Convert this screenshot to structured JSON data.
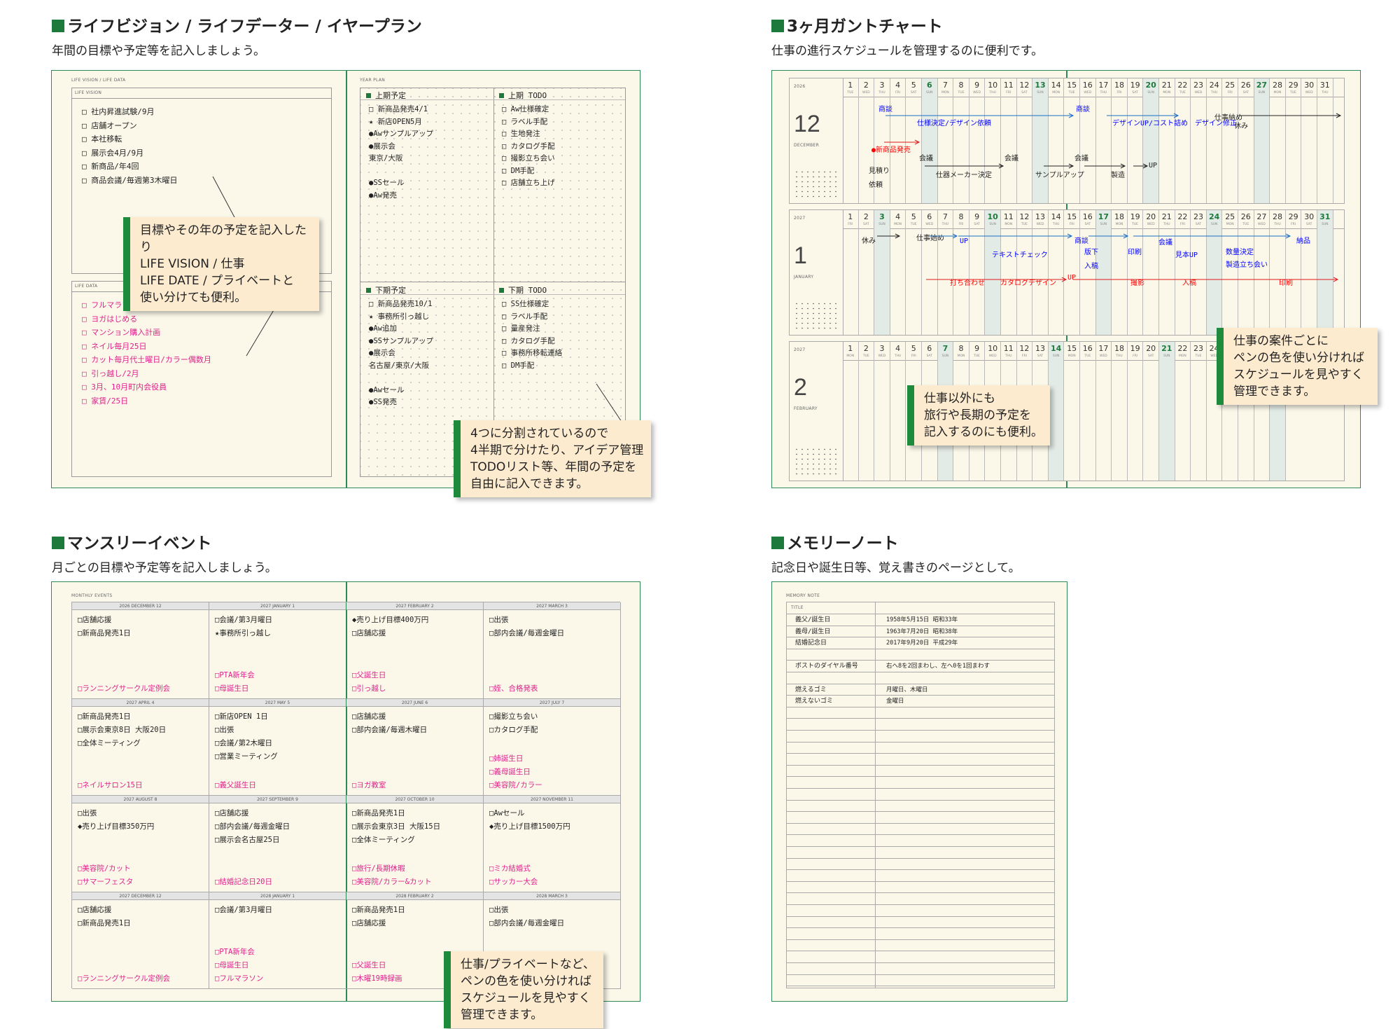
{
  "sections": {
    "life": {
      "title": "ライフビジョン / ライフデーター / イヤープラン",
      "sub": "年間の目標や予定等を記入しましょう。"
    },
    "gantt": {
      "title": "3ヶ月ガントチャート",
      "sub": "仕事の進行スケジュールを管理するのに便利です。"
    },
    "monthly": {
      "title": "マンスリーイベント",
      "sub": "月ごとの目標や予定等を記入しましょう。"
    },
    "memory": {
      "title": "メモリーノート",
      "sub": "記念日や誕生日等、覚え書きのページとして。"
    }
  },
  "life_page": {
    "header_left": "LIFE VISION / LIFE DATA",
    "vision_label": "LIFE VISION",
    "vision_items": [
      "□ 社内昇進試験/9月",
      "□ 店舗オープン",
      "□ 本社移転",
      "□ 展示会4月/9月",
      "□ 新商品/年4回",
      "□ 商品会議/毎週第3木曜日"
    ],
    "data_label": "LIFE DATA",
    "data_items": [
      "□ フルマラソン完走!",
      "□ ヨガはじめる",
      "□ マンション購入計画",
      "□ ネイル毎月25日",
      "□ カット毎月代土曜日/カラー偶数月",
      "□ 引っ越し/2月",
      "□ 3月、10月町内会役員",
      "□ 家賃/25日"
    ],
    "header_right": "YEAR PLAN",
    "q1_head": "上期予定",
    "q1_items": [
      "□ 新商品発売4/1",
      "★ 新店OPEN5月",
      "●Awサンプルアップ",
      "●展示会",
      "  東京/大阪",
      "",
      "●SSセール",
      "●Aw発売"
    ],
    "q2_head": "上期 TODO",
    "q2_items": [
      "□ Aw仕様確定",
      "□ ラベル手配",
      "□ 生地発注",
      "□ カタログ手配",
      "□ 撮影立ち会い",
      "□ DM手配",
      "□ 店舗立ち上げ"
    ],
    "q3_head": "下期予定",
    "q3_items": [
      "□ 新商品発売10/1",
      "★ 事務所引っ越し",
      "●Aw追加",
      "●SSサンプルアップ",
      "●展示会",
      "  名古屋/東京/大阪",
      "",
      "●Awセール",
      "●SS発売"
    ],
    "q4_head": "下期 TODO",
    "q4_items": [
      "□ SS仕様確定",
      "□ ラベル手配",
      "□ 量産発注",
      "□ カタログ手配",
      "□ 事務所移転連絡",
      "□ DM手配"
    ],
    "callout1": [
      "目標やその年の予定を記入したり",
      "LIFE VISION / 仕事",
      "LIFE DATE / プライベートと",
      "使い分けても便利。"
    ],
    "callout2": [
      "4つに分割されているので",
      "4半期で分けたり、アイデア管理",
      "TODOリスト等、年間の予定を",
      "自由に記入できます。"
    ]
  },
  "gantt_page": {
    "months": [
      {
        "year": "2026",
        "num": "12",
        "name": "DECEMBER"
      },
      {
        "year": "2027",
        "num": "1",
        "name": "JANUARY"
      },
      {
        "year": "2027",
        "num": "2",
        "name": "FEBRUARY"
      }
    ],
    "dec_texts": [
      "商談",
      "仕様決定/デザイン依頼",
      "商談",
      "デザインUP/コスト詰め",
      "デザイン修正",
      "仕事納め",
      "休み",
      "●新商品発売",
      "見積り",
      "依頼",
      "会議",
      "仕器メーカー決定",
      "会議",
      "サンプルアップ",
      "会議",
      "製造",
      "UP"
    ],
    "jan_texts": [
      "休み",
      "仕事始め",
      "UP",
      "テキストチェック",
      "商談",
      "版下",
      "入稿",
      "印刷",
      "会議",
      "見本UP",
      "数量決定",
      "製造立ち会い",
      "納品",
      "打ち合わせ",
      "カタログデザイン",
      "UP",
      "撮影",
      "入稿",
      "印刷"
    ],
    "callout1": [
      "仕事以外にも",
      "旅行や長期の予定を",
      "記入するのにも便利。"
    ],
    "callout2": [
      "仕事の案件ごとに",
      "ペンの色を使い分ければ",
      "スケジュールを見やすく",
      "管理できます。"
    ]
  },
  "monthly_page": {
    "header": "MONTHLY EVENTS",
    "cells": [
      {
        "head": "2026 DECEMBER 12",
        "top": [
          "□店舗応援",
          "□新商品発売1日"
        ],
        "bot": [
          "□ランニングサークル定例会"
        ]
      },
      {
        "head": "2027 JANUARY 1",
        "top": [
          "□会議/第3月曜日",
          "★事務所引っ越し"
        ],
        "bot": [
          "□PTA新年会",
          "□母誕生日"
        ]
      },
      {
        "head": "2027 FEBRUARY 2",
        "top": [
          "◆売り上げ目標400万円",
          "□店舗応援"
        ],
        "bot": [
          "□父誕生日",
          "□引っ越し"
        ]
      },
      {
        "head": "2027 MARCH 3",
        "top": [
          "□出張",
          "□部内会議/毎週金曜日"
        ],
        "bot": [
          "□姪、合格発表"
        ]
      },
      {
        "head": "2027 APRIL 4",
        "top": [
          "□新商品発売1日",
          "□展示会東京8日 大阪20日",
          "□全体ミーティング"
        ],
        "bot": [
          "□ネイルサロン15日"
        ]
      },
      {
        "head": "2027 MAY 5",
        "top": [
          "□新店OPEN 1日",
          "□出張",
          "□会議/第2木曜日",
          "□営業ミーティング"
        ],
        "bot": [
          "□義父誕生日"
        ]
      },
      {
        "head": "2027 JUNE 6",
        "top": [
          "□店舗応援",
          "□部内会議/毎週木曜日"
        ],
        "bot": [
          "□ヨガ教室"
        ]
      },
      {
        "head": "2027 JULY 7",
        "top": [
          "□撮影立ち会い",
          "□カタログ手配"
        ],
        "bot": [
          "□姉誕生日",
          "□義母誕生日",
          "□美容院/カラー"
        ]
      },
      {
        "head": "2027 AUGUST 8",
        "top": [
          "□出張",
          "◆売り上げ目標350万円"
        ],
        "bot": [
          "□美容院/カット",
          "□サマーフェスタ"
        ]
      },
      {
        "head": "2027 SEPTEMBER 9",
        "top": [
          "□店舗応援",
          "□部内会議/毎週金曜日",
          "□展示会名古屋25日"
        ],
        "bot": [
          "□結婚記念日20日"
        ]
      },
      {
        "head": "2027 OCTOBER 10",
        "top": [
          "□新商品発売1日",
          "□展示会東京3日 大阪15日",
          "□全体ミーティング"
        ],
        "bot": [
          "□旅行/長期休暇",
          "□美容院/カラー&カット"
        ]
      },
      {
        "head": "2027 NOVEMBER 11",
        "top": [
          "□Awセール",
          "◆売り上げ目標1500万円"
        ],
        "bot": [
          "□ミカ結婚式",
          "□サッカー大会"
        ]
      },
      {
        "head": "2027 DECEMBER 12",
        "top": [
          "□店舗応援",
          "□新商品発売1日"
        ],
        "bot": [
          "□ランニングサークル定例会"
        ]
      },
      {
        "head": "2028 JANUARY 1",
        "top": [
          "□会議/第3月曜日"
        ],
        "bot": [
          "□PTA新年会",
          "□母誕生日",
          "□フルマラソン"
        ]
      },
      {
        "head": "2028 FEBRUARY 2",
        "top": [
          "□新商品発売1日",
          "□店舗応援"
        ],
        "bot": [
          "□父誕生日",
          "□木曜19時録画"
        ]
      },
      {
        "head": "2028 MARCH 3",
        "top": [
          "□出張",
          "□部内会議/毎週金曜日"
        ],
        "bot": []
      }
    ],
    "callout": [
      "仕事/プライベートなど、",
      "ペンの色を使い分ければ",
      "スケジュールを見やすく",
      "管理できます。"
    ]
  },
  "memory_page": {
    "header": "MEMORY NOTE",
    "col_title": "TITLE",
    "rows": [
      {
        "k": "義父/誕生日",
        "v": "1958年5月15日  昭和33年"
      },
      {
        "k": "義母/誕生日",
        "v": "1963年7月20日  昭和38年"
      },
      {
        "k": "結婚記念日",
        "v": "2017年9月20日  平成29年"
      },
      {
        "k": "",
        "v": ""
      },
      {
        "k": "ポストのダイヤル番号",
        "v": "右へ8を2回まわし、左へ0を1回まわす"
      },
      {
        "k": "",
        "v": ""
      },
      {
        "k": "燃えるゴミ",
        "v": "月曜日、木曜日"
      },
      {
        "k": "燃えないゴミ",
        "v": "金曜日"
      }
    ]
  }
}
